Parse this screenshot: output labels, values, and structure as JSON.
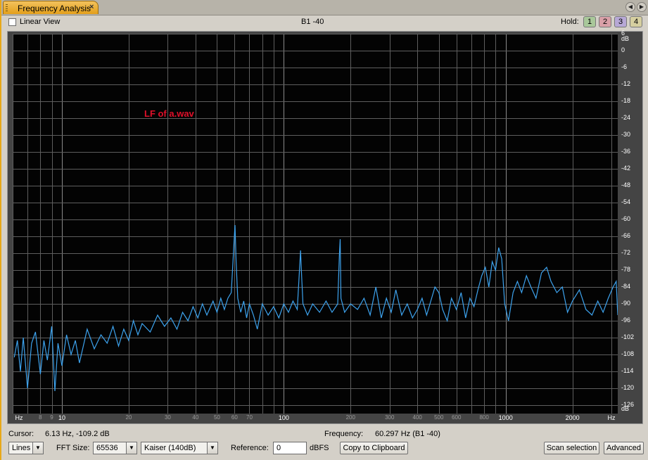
{
  "tab": {
    "title": "Frequency Analysis",
    "close": "×"
  },
  "topbar": {
    "linear_view_label": "Linear View",
    "band_label": "B1 -40",
    "hold_label": "Hold:",
    "hold_buttons": [
      {
        "label": "1",
        "color": "#a9c89a"
      },
      {
        "label": "2",
        "color": "#d9a0a8"
      },
      {
        "label": "3",
        "color": "#b7a8d6"
      },
      {
        "label": "4",
        "color": "#d6cfa0"
      }
    ]
  },
  "plot": {
    "annotation": "LF of a.wav",
    "trace_color": "#3da3ee",
    "y_unit": "dB",
    "x_unit": "Hz",
    "y_ticks": [
      "6",
      "0",
      "-6",
      "-12",
      "-18",
      "-24",
      "-30",
      "-36",
      "-42",
      "-48",
      "-54",
      "-60",
      "-66",
      "-72",
      "-78",
      "-84",
      "-90",
      "-96",
      "-102",
      "-108",
      "-114",
      "-120",
      "-126"
    ],
    "x_ticks": [
      {
        "label": "8",
        "minor": true,
        "f": 8
      },
      {
        "label": "9",
        "minor": true,
        "f": 9
      },
      {
        "label": "10",
        "minor": false,
        "f": 10
      },
      {
        "label": "20",
        "minor": true,
        "f": 20
      },
      {
        "label": "30",
        "minor": true,
        "f": 30
      },
      {
        "label": "40",
        "minor": true,
        "f": 40
      },
      {
        "label": "50",
        "minor": true,
        "f": 50
      },
      {
        "label": "60",
        "minor": true,
        "f": 60
      },
      {
        "label": "70",
        "minor": true,
        "f": 70
      },
      {
        "label": "100",
        "minor": false,
        "f": 100
      },
      {
        "label": "200",
        "minor": true,
        "f": 200
      },
      {
        "label": "300",
        "minor": true,
        "f": 300
      },
      {
        "label": "400",
        "minor": true,
        "f": 400
      },
      {
        "label": "500",
        "minor": true,
        "f": 500
      },
      {
        "label": "600",
        "minor": true,
        "f": 600
      },
      {
        "label": "800",
        "minor": true,
        "f": 800
      },
      {
        "label": "1000",
        "minor": false,
        "f": 1000
      },
      {
        "label": "2000",
        "minor": false,
        "f": 2000
      }
    ]
  },
  "chart_data": {
    "type": "line",
    "x_scale": "log",
    "xlim_hz": [
      6,
      3200
    ],
    "ylim_db": [
      -129,
      6
    ],
    "grid": true,
    "series": [
      {
        "points": [
          [
            6.1,
            -109
          ],
          [
            6.3,
            -103
          ],
          [
            6.5,
            -114
          ],
          [
            6.7,
            -102
          ],
          [
            7.0,
            -120
          ],
          [
            7.3,
            -104
          ],
          [
            7.6,
            -100
          ],
          [
            8.0,
            -115
          ],
          [
            8.3,
            -103
          ],
          [
            8.6,
            -110
          ],
          [
            9.0,
            -98
          ],
          [
            9.3,
            -121
          ],
          [
            9.6,
            -104
          ],
          [
            10.0,
            -112
          ],
          [
            10.5,
            -101
          ],
          [
            11,
            -108
          ],
          [
            11.5,
            -103
          ],
          [
            12,
            -111
          ],
          [
            13,
            -99
          ],
          [
            14,
            -106
          ],
          [
            15,
            -101
          ],
          [
            16,
            -104
          ],
          [
            17,
            -98
          ],
          [
            18,
            -105
          ],
          [
            19,
            -99
          ],
          [
            20,
            -103
          ],
          [
            21,
            -96
          ],
          [
            22,
            -101
          ],
          [
            23,
            -97
          ],
          [
            25,
            -100
          ],
          [
            27,
            -94
          ],
          [
            29,
            -98
          ],
          [
            31,
            -95
          ],
          [
            33,
            -99
          ],
          [
            35,
            -93
          ],
          [
            37,
            -96
          ],
          [
            39,
            -91
          ],
          [
            41,
            -95
          ],
          [
            43,
            -90
          ],
          [
            45,
            -94
          ],
          [
            48,
            -89
          ],
          [
            50,
            -93
          ],
          [
            52,
            -88
          ],
          [
            54,
            -92
          ],
          [
            56,
            -88
          ],
          [
            58,
            -86
          ],
          [
            59.5,
            -70
          ],
          [
            60.3,
            -62
          ],
          [
            61,
            -75
          ],
          [
            62,
            -88
          ],
          [
            64,
            -93
          ],
          [
            66,
            -89
          ],
          [
            68,
            -95
          ],
          [
            70,
            -90
          ],
          [
            73,
            -94
          ],
          [
            76,
            -99
          ],
          [
            80,
            -90
          ],
          [
            85,
            -94
          ],
          [
            90,
            -91
          ],
          [
            95,
            -95
          ],
          [
            100,
            -90
          ],
          [
            105,
            -93
          ],
          [
            110,
            -89
          ],
          [
            115,
            -92
          ],
          [
            119,
            -71
          ],
          [
            120,
            -78
          ],
          [
            122,
            -90
          ],
          [
            128,
            -94
          ],
          [
            135,
            -90
          ],
          [
            145,
            -93
          ],
          [
            155,
            -89
          ],
          [
            165,
            -93
          ],
          [
            175,
            -90
          ],
          [
            178,
            -73
          ],
          [
            179.5,
            -67
          ],
          [
            181,
            -88
          ],
          [
            188,
            -93
          ],
          [
            200,
            -90
          ],
          [
            215,
            -92
          ],
          [
            230,
            -88
          ],
          [
            245,
            -94
          ],
          [
            260,
            -84
          ],
          [
            275,
            -95
          ],
          [
            290,
            -88
          ],
          [
            305,
            -93
          ],
          [
            320,
            -85
          ],
          [
            340,
            -94
          ],
          [
            360,
            -90
          ],
          [
            380,
            -95
          ],
          [
            400,
            -92
          ],
          [
            420,
            -88
          ],
          [
            440,
            -94
          ],
          [
            460,
            -89
          ],
          [
            480,
            -84
          ],
          [
            500,
            -86
          ],
          [
            520,
            -92
          ],
          [
            545,
            -96
          ],
          [
            570,
            -88
          ],
          [
            600,
            -92
          ],
          [
            630,
            -86
          ],
          [
            660,
            -95
          ],
          [
            690,
            -88
          ],
          [
            720,
            -91
          ],
          [
            750,
            -85
          ],
          [
            780,
            -80
          ],
          [
            810,
            -77
          ],
          [
            840,
            -84
          ],
          [
            870,
            -75
          ],
          [
            900,
            -78
          ],
          [
            930,
            -70
          ],
          [
            960,
            -74
          ],
          [
            990,
            -90
          ],
          [
            1030,
            -96
          ],
          [
            1080,
            -86
          ],
          [
            1130,
            -82
          ],
          [
            1180,
            -86
          ],
          [
            1240,
            -80
          ],
          [
            1300,
            -84
          ],
          [
            1370,
            -88
          ],
          [
            1450,
            -79
          ],
          [
            1530,
            -77
          ],
          [
            1600,
            -82
          ],
          [
            1700,
            -86
          ],
          [
            1800,
            -84
          ],
          [
            1900,
            -93
          ],
          [
            2000,
            -89
          ],
          [
            2150,
            -85
          ],
          [
            2300,
            -92
          ],
          [
            2450,
            -94
          ],
          [
            2600,
            -89
          ],
          [
            2750,
            -93
          ],
          [
            2900,
            -88
          ],
          [
            3050,
            -84
          ],
          [
            3150,
            -82
          ],
          [
            3200,
            -94
          ]
        ]
      }
    ]
  },
  "status": {
    "cursor_label": "Cursor:",
    "cursor_value": "6.13 Hz, -109.2 dB",
    "frequency_label": "Frequency:",
    "frequency_value": "60.297 Hz (B1 -40)"
  },
  "controls": {
    "mode_value": "Lines",
    "fft_label": "FFT Size:",
    "fft_value": "65536",
    "window_value": "Kaiser (140dB)",
    "reference_label": "Reference:",
    "reference_value": "0",
    "reference_unit": "dBFS",
    "copy_label": "Copy to Clipboard",
    "scan_label": "Scan selection",
    "advanced_label": "Advanced"
  }
}
